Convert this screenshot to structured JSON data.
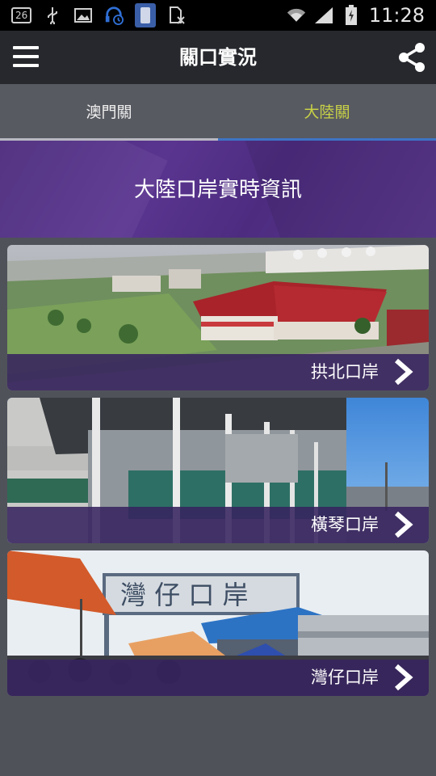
{
  "status_bar": {
    "notification_badge": "26",
    "time": "11:28",
    "icons": [
      "usb-icon",
      "image-icon",
      "headset-icon",
      "phone-icon",
      "no-sim-icon",
      "wifi-icon",
      "signal-icon",
      "battery-icon"
    ]
  },
  "app_bar": {
    "title": "關口實況",
    "menu_icon": "hamburger-menu-icon",
    "share_icon": "share-icon"
  },
  "tabs": [
    {
      "label": "澳門關",
      "selected": false
    },
    {
      "label": "大陸關",
      "selected": true
    }
  ],
  "banner": {
    "title": "大陸口岸實時資訊"
  },
  "ports": [
    {
      "name": "拱北口岸"
    },
    {
      "name": "橫琴口岸"
    },
    {
      "name": "灣仔口岸"
    }
  ],
  "colors": {
    "background": "#50525a",
    "app_bar": "#26282d",
    "tab_bar": "#585a61",
    "selected_tab_text": "#c8d246",
    "tab_indicator": "#3e74c4",
    "banner_purple": "#5a3590"
  }
}
